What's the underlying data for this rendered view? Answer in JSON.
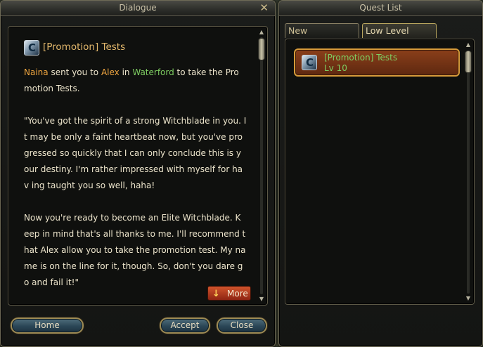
{
  "dialogue": {
    "title": "Dialogue",
    "close_label": "✕",
    "quest_title": "[Promotion] Tests",
    "intro": {
      "name1": "Naina",
      "t1": " sent you to ",
      "name2": "Alex",
      "t2": " in ",
      "place": "Waterford",
      "t3": " to take the Pro motion Tests."
    },
    "paragraph2": "\"You've got the spirit of a strong Witchblade in you. It may be only a faint heartbeat now, but you've pro gressed so quickly that I can only conclude this is y our destiny. I'm rather impressed with myself for hav ing taught you so well, haha!",
    "paragraph3": "Now you're ready to become an Elite Witchblade. K eep in mind that's all thanks to me. I'll recommend t hat Alex allow you to take the promotion test. My na me is on the line for it, though. So, don't you dare g o and fail it!\"",
    "more_label": "More",
    "home_label": "Home",
    "accept_label": "Accept",
    "close_button_label": "Close"
  },
  "quest_list": {
    "title": "Quest List",
    "tabs": [
      {
        "label": "New",
        "active": false
      },
      {
        "label": "Low Level",
        "active": true
      }
    ],
    "items": [
      {
        "name": "[Promotion] Tests",
        "level": "Lv 10",
        "selected": true
      }
    ]
  },
  "colors": {
    "highlight_npc": "#f0a640",
    "highlight_place": "#7fcf62",
    "selected_item": "#d69a3a"
  }
}
